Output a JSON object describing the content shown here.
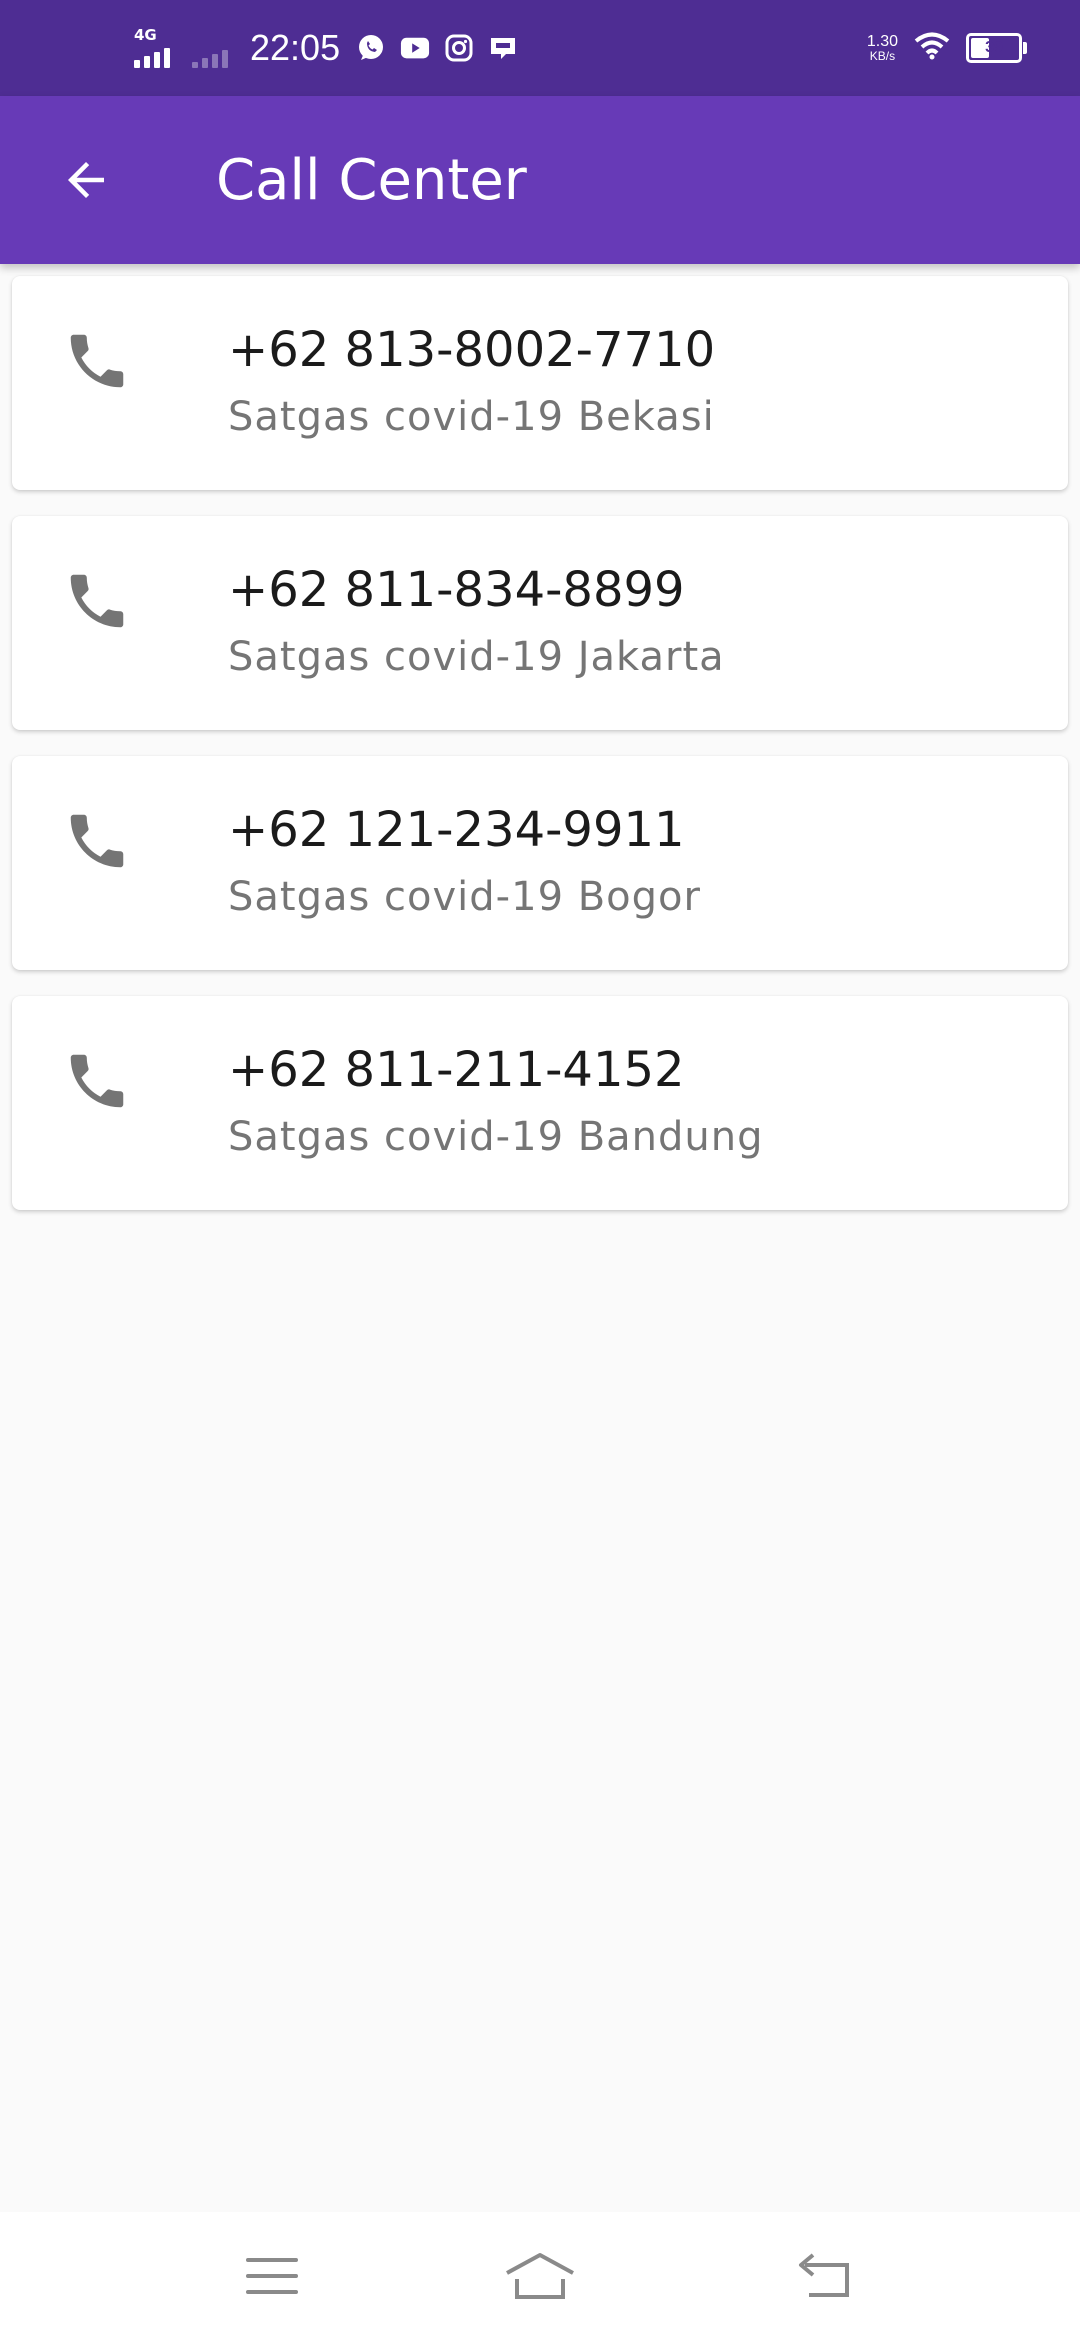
{
  "status_bar": {
    "network": "4G",
    "time": "22:05",
    "speed_value": "1.30",
    "speed_unit": "KB/s",
    "battery": "39",
    "battery_level": 0.39,
    "app_icons": [
      "whatsapp-icon",
      "youtube-icon",
      "instagram-icon",
      "line-icon"
    ]
  },
  "app_bar": {
    "title": "Call Center",
    "back_icon": "arrow-back-icon",
    "color": "#673ab7"
  },
  "contacts": [
    {
      "number": "+62 813-8002-7710",
      "label": "Satgas covid-19 Bekasi"
    },
    {
      "number": "+62 811-834-8899",
      "label": "Satgas covid-19 Jakarta"
    },
    {
      "number": "+62 121-234-9911",
      "label": "Satgas covid-19 Bogor"
    },
    {
      "number": "+62 811-211-4152",
      "label": "Satgas covid-19 Bandung"
    }
  ],
  "nav_bar": {
    "icons": [
      "menu-icon",
      "home-icon",
      "back-icon"
    ]
  },
  "colors": {
    "status_bar": "#4e2d93",
    "accent": "#673ab7",
    "background": "#fafafa",
    "icon_gray": "#757575"
  }
}
